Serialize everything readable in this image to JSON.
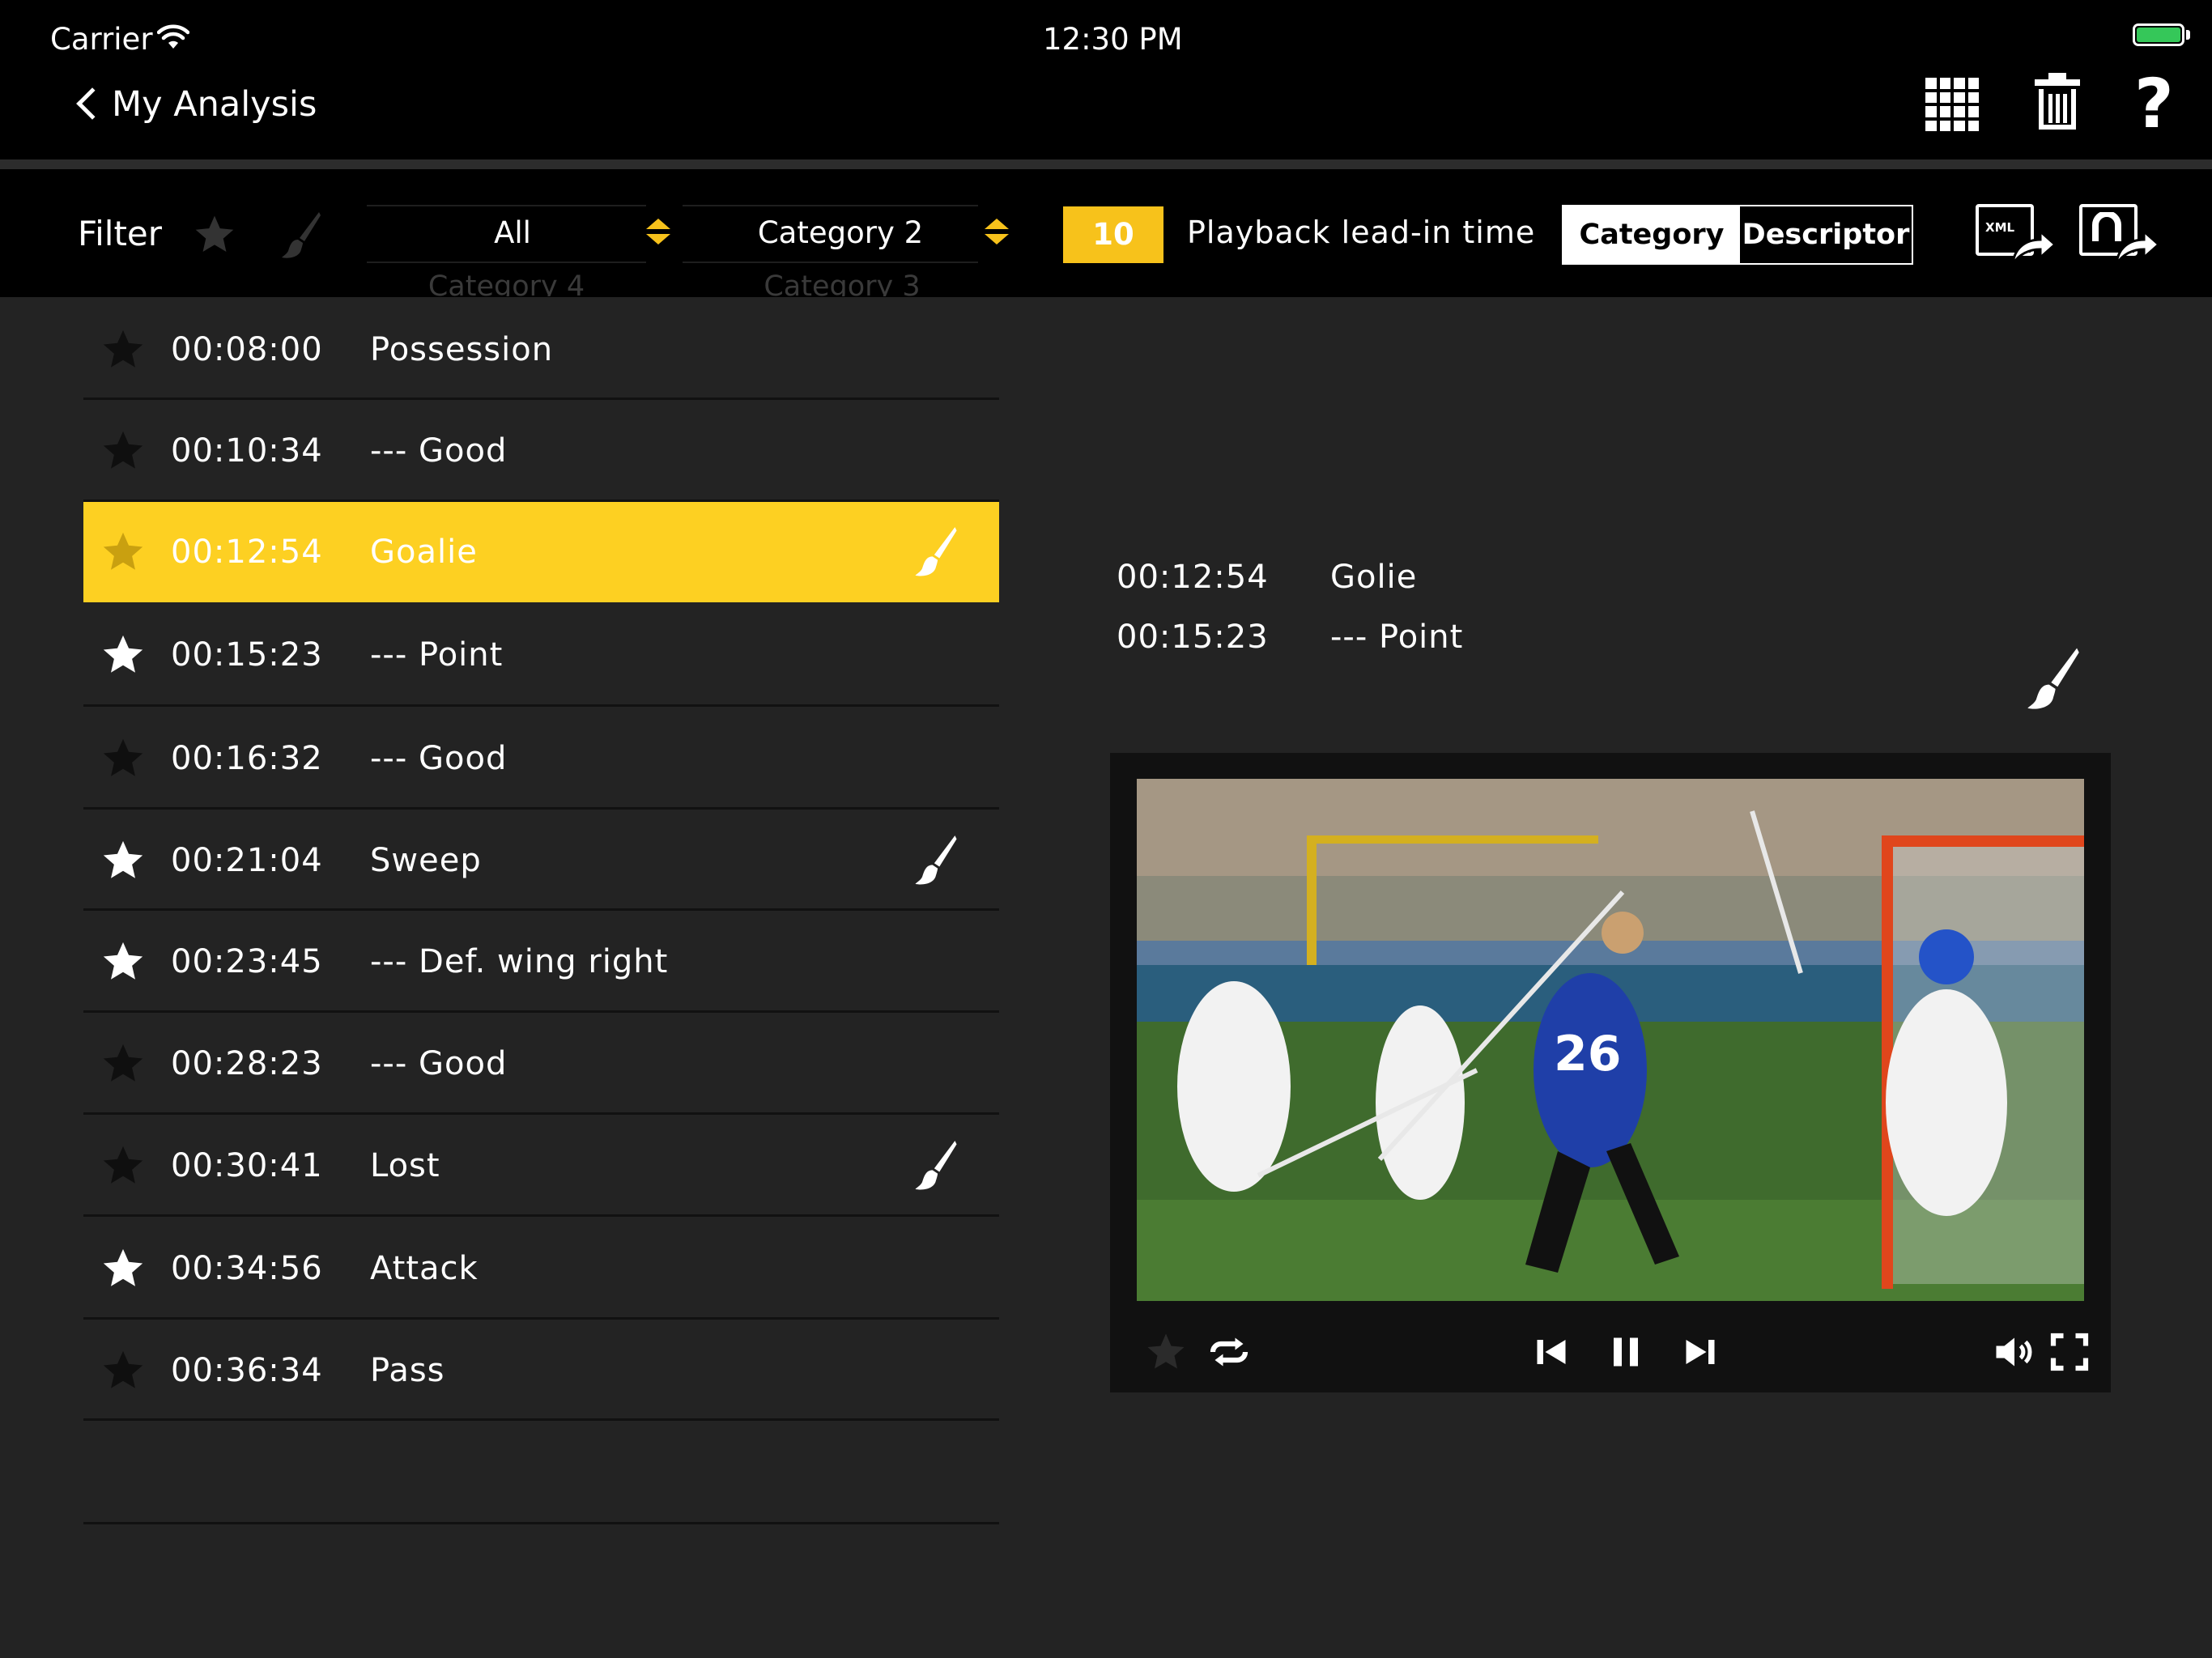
{
  "status_bar": {
    "carrier": "Carrier",
    "time": "12:30 PM"
  },
  "nav": {
    "back_label": "My Analysis",
    "icons": [
      "grid-icon",
      "trash-icon",
      "help-icon"
    ],
    "help_text": "?"
  },
  "filter_bar": {
    "label": "Filter",
    "picker1": {
      "selected": "All",
      "ghost": "Category 4"
    },
    "picker2": {
      "selected": "Category 2",
      "ghost": "Category 3"
    },
    "lead_in": {
      "value": "10",
      "label": "Playback lead-in time"
    },
    "segment": {
      "left": "Category",
      "right": "Descriptor",
      "selected": "Category"
    },
    "export_icons": [
      "xml-export-icon",
      "share-export-icon"
    ],
    "export_xml_text": "XML"
  },
  "colors": {
    "accent": "#f7c21b",
    "selected_row": "#fdd022",
    "background": "#232323",
    "bar": "#000000"
  },
  "events": [
    {
      "time": "00:08:00",
      "label": "Possession",
      "starred": false,
      "brush": false,
      "selected": false
    },
    {
      "time": "00:10:34",
      "label": "--- Good",
      "starred": false,
      "brush": false,
      "selected": false
    },
    {
      "time": "00:12:54",
      "label": "Goalie",
      "starred": false,
      "brush": true,
      "selected": true
    },
    {
      "time": "00:15:23",
      "label": "--- Point",
      "starred": true,
      "brush": false,
      "selected": false
    },
    {
      "time": "00:16:32",
      "label": "--- Good",
      "starred": false,
      "brush": false,
      "selected": false
    },
    {
      "time": "00:21:04",
      "label": "Sweep",
      "starred": true,
      "brush": true,
      "selected": false
    },
    {
      "time": "00:23:45",
      "label": "--- Def. wing right",
      "starred": true,
      "brush": false,
      "selected": false
    },
    {
      "time": "00:28:23",
      "label": "--- Good",
      "starred": false,
      "brush": false,
      "selected": false
    },
    {
      "time": "00:30:41",
      "label": "Lost",
      "starred": false,
      "brush": true,
      "selected": false
    },
    {
      "time": "00:34:56",
      "label": "Attack",
      "starred": true,
      "brush": false,
      "selected": false
    },
    {
      "time": "00:36:34",
      "label": "Pass",
      "starred": false,
      "brush": false,
      "selected": false
    }
  ],
  "detail": {
    "lines": [
      {
        "time": "00:12:54",
        "label": "Golie"
      },
      {
        "time": "00:15:23",
        "label": "--- Point"
      }
    ]
  },
  "video": {
    "controls": [
      "star-icon",
      "loop-icon",
      "previous-icon",
      "pause-icon",
      "next-icon",
      "volume-icon",
      "fullscreen-icon"
    ],
    "jersey_number": "26"
  }
}
